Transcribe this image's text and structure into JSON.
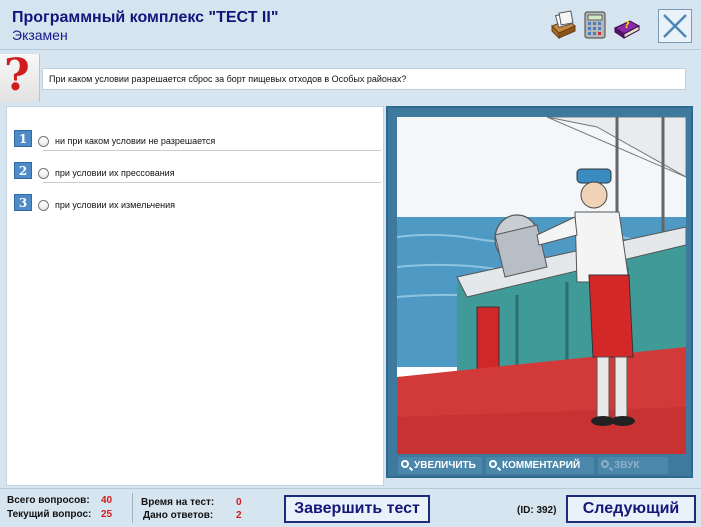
{
  "header": {
    "title": "Программный комплекс \"ТЕСТ II\"",
    "subtitle": "Экзамен"
  },
  "toolbar": {
    "icons": [
      "card-file-icon",
      "calculator-icon",
      "help-book-icon",
      "close-icon"
    ]
  },
  "question": {
    "text": "При каком условии разрешается сброс за борт пищевых отходов в Особых районах?"
  },
  "answers": [
    {
      "number": "1",
      "text": "ни при каком условии не разрешается"
    },
    {
      "number": "2",
      "text": "при условии их прессования"
    },
    {
      "number": "3",
      "text": "при условии их измельчения"
    }
  ],
  "image_controls": {
    "zoom_label": "УВЕЛИЧИТЬ",
    "comment_label": "КОММЕНТАРИЙ",
    "sound_label": "ЗВУК"
  },
  "footer": {
    "total_label": "Всего вопросов:",
    "total_value": "40",
    "current_label": "Текущий вопрос:",
    "current_value": "25",
    "time_label": "Время на тест:",
    "time_value": "0",
    "answered_label": "Дано ответов:",
    "answered_value": "2",
    "finish_label": "Завершить тест",
    "id_label": "(ID: 392)",
    "next_label": "Следующий"
  },
  "colors": {
    "title": "#14147a",
    "accent_red": "#d01c1c",
    "panel_blue": "#3d7a9e",
    "answer_number": "#4e8ac8"
  }
}
